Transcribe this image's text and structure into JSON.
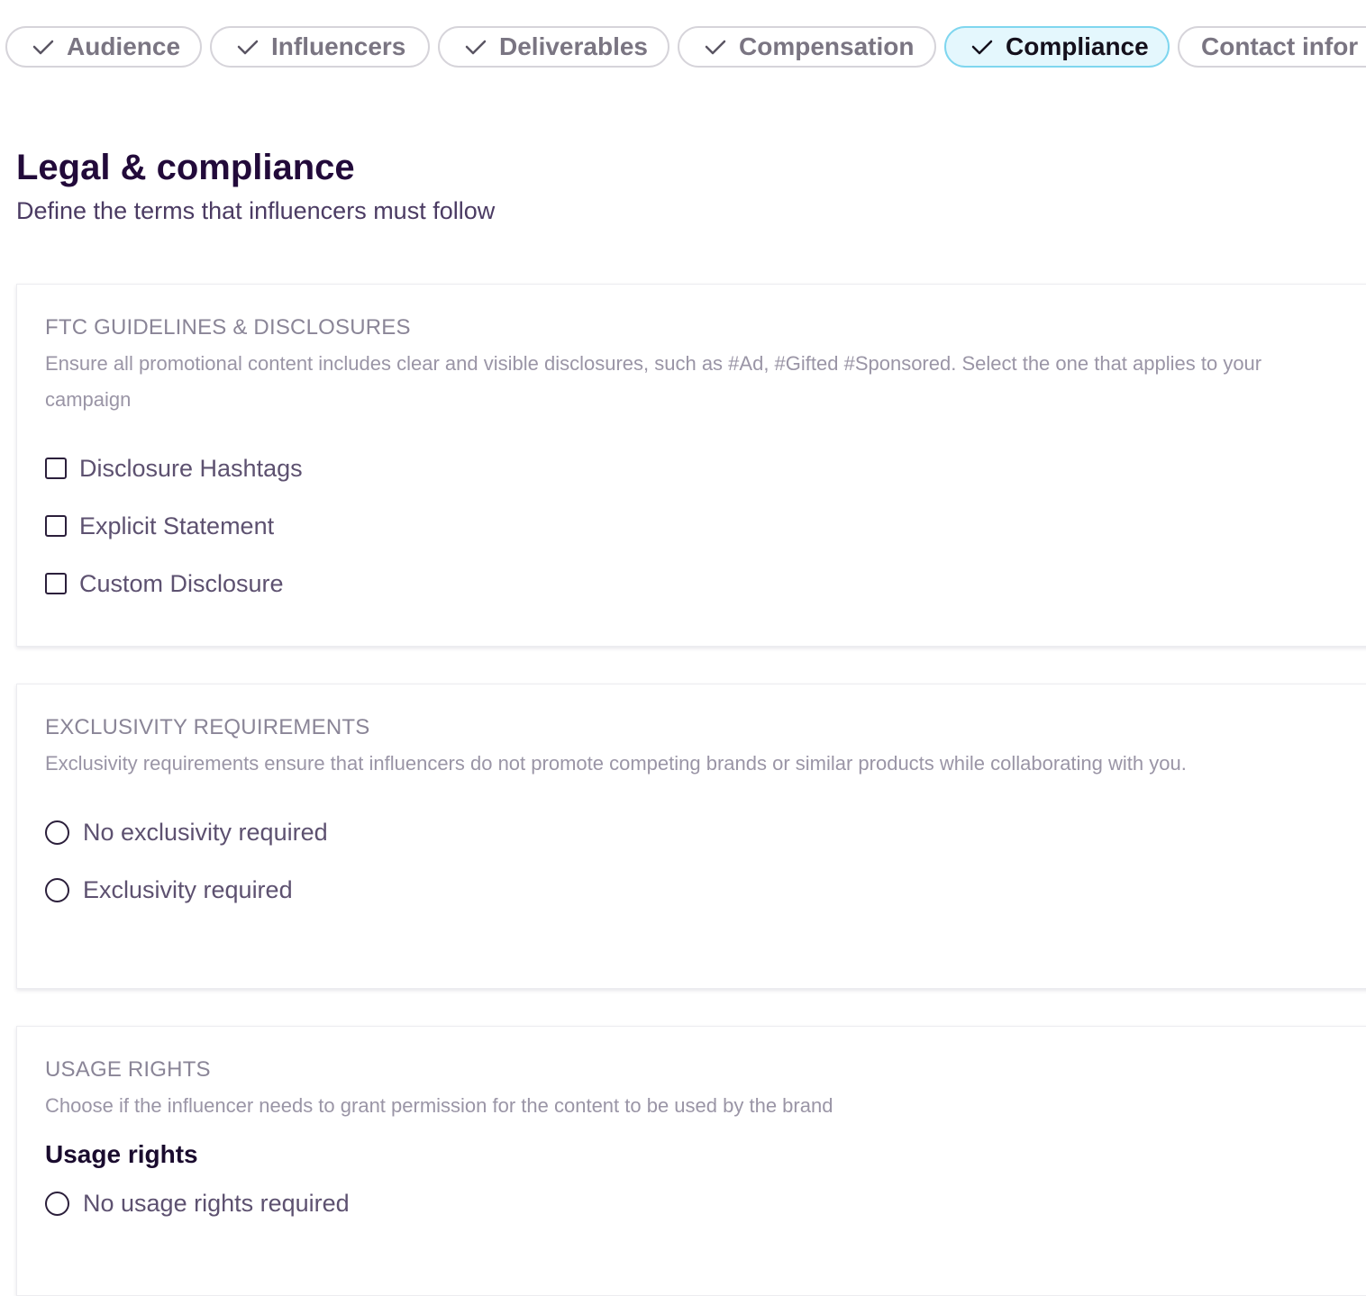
{
  "stepper": {
    "steps": [
      {
        "label": "Audience",
        "state": "complete"
      },
      {
        "label": "Influencers",
        "state": "complete"
      },
      {
        "label": "Deliverables",
        "state": "complete"
      },
      {
        "label": "Compensation",
        "state": "complete"
      },
      {
        "label": "Compliance",
        "state": "active"
      },
      {
        "label": "Contact infor",
        "state": "upcoming"
      }
    ]
  },
  "page": {
    "title": "Legal & compliance",
    "subtitle": "Define the terms that influencers must follow"
  },
  "ftc": {
    "title": "FTC GUIDELINES & DISCLOSURES",
    "description": "Ensure all promotional content includes clear and visible disclosures, such as #Ad, #Gifted #Sponsored. Select the one that applies to your campaign",
    "options": [
      "Disclosure Hashtags",
      "Explicit Statement",
      "Custom Disclosure"
    ]
  },
  "exclusivity": {
    "title": "EXCLUSIVITY REQUIREMENTS",
    "description": "Exclusivity requirements ensure that influencers do not promote competing brands or similar products while collaborating with you.",
    "options": [
      "No exclusivity required",
      "Exclusivity required"
    ]
  },
  "usage": {
    "title": "USAGE RIGHTS",
    "description": "Choose if the influencer needs to grant permission for the content to be used by the brand",
    "field_label": "Usage rights",
    "options": [
      "No usage rights required"
    ]
  },
  "colors": {
    "active_step_bg": "#e4f7fd",
    "active_step_border": "#7fd6ef",
    "title": "#220a3a",
    "muted": "#8a8597"
  },
  "icons": {
    "step_check": "check-icon"
  }
}
